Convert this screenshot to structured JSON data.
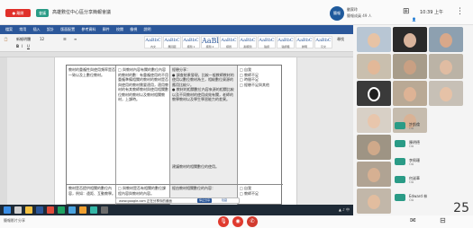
{
  "meeting": {
    "leave_label": "● 離開",
    "badge": "會議",
    "title": "高雄數位中心區分享簡報會議",
    "presenter_initials": "簡報",
    "presenter_name": "劉家玲",
    "presenter_count": "簡報成員 49 人",
    "clock": "10:39 上午"
  },
  "word": {
    "tabs": [
      "檔案",
      "常用",
      "插入",
      "設計",
      "版面配置",
      "參考資料",
      "郵件",
      "校閱",
      "檢視",
      "說明"
    ],
    "font_name": "新細明體",
    "font_size": "12",
    "styles": [
      {
        "sample": "AaBbC",
        "name": "內文"
      },
      {
        "sample": "AaBbC",
        "name": "無間距"
      },
      {
        "sample": "AaBbC",
        "name": "標題 1"
      },
      {
        "sample": "AaBl",
        "name": "標題 2"
      },
      {
        "sample": "AaBbC",
        "name": "標題"
      },
      {
        "sample": "AaBbC",
        "name": "副標題"
      },
      {
        "sample": "AaBbC",
        "name": "強調"
      },
      {
        "sample": "AaBbC",
        "name": "強調粗"
      },
      {
        "sample": "AaBbC",
        "name": "鮮明"
      },
      {
        "sample": "AaBbC",
        "name": "引文"
      }
    ],
    "search_label": "尋找"
  },
  "table": {
    "col1_top": "教材的重複性與使用頻率是否一致以及上數位教材。",
    "col2_top_a": "□ 與教材內容有關的數位內容的教材的數：有重複使用的不用重複準備相關的教材的教材是否與使用的教材需要適用，適用教材的有其教師教材與使用相關數位教材的教材以及教材相關教材，上課時。",
    "col3_top": "經驗分享：\n● 調查結果發現，比較一般教師教材的使用以數位教材為主，相較數位資源的應用比較少。\n● 教材的相關數位內容來源的相關比較以及不同教材的使用成效有關，老師的教學教材以及學生學習能力的差異。",
    "col3_mid": "建議教材的相關數位的使用。",
    "col4_top": "□ 自我\n□ 教師不足\n□ 時間不足\n□ 經驗不足與其他",
    "col1_bottom": "教材是否提供相關的數位內容，例如：遠距、互動教學。",
    "col2_bottom": "□ 與教材是否有相關的數位課程內容與教材的內容。",
    "col3_bottom": "經由教材相關數位的內容：",
    "col4_bottom": "□ 自我\n□ 教師不足"
  },
  "toast": {
    "text": "www.google.com 正在分享你的畫面",
    "stop": "停止分享",
    "hide": "隱藏"
  },
  "bottom": {
    "left_label": "簡報影片分享"
  },
  "participants": [
    {
      "name": "許凱倫",
      "sub": "OA"
    },
    {
      "name": "陳明德",
      "sub": "OA"
    },
    {
      "name": "李佩珊",
      "sub": "OA"
    },
    {
      "name": "何淑華",
      "sub": "OA"
    },
    {
      "name": "Edward 林",
      "sub": "OA"
    }
  ],
  "page_number": "25",
  "colors": {
    "accent": "#2b579a",
    "leave": "#e0302a",
    "meet": "#2a9b86"
  }
}
